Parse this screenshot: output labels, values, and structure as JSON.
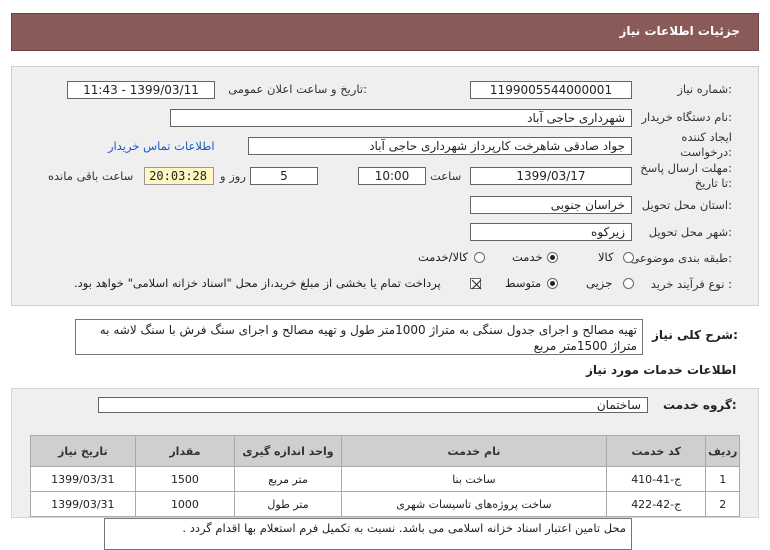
{
  "header": {
    "title": "جزئیات اطلاعات نیاز"
  },
  "form": {
    "need_number_label": "شماره نیاز:",
    "need_number": "1199005544000001",
    "announce_label": "تاریخ و ساعت اعلان عمومی:",
    "announce_value": "1399/03/11 - 11:43",
    "buyer_org_label": "نام دستگاه خریدار:",
    "buyer_org": "شهرداری حاجی آباد",
    "creator_label_1": "ایجاد کننده",
    "creator_label_2": "درخواست:",
    "creator": "جواد صادقی شاهرخت کارپرداز شهرداری حاجی آباد",
    "contact_link": "اطلاعات تماس خریدار",
    "deadline_label_1": "مهلت ارسال پاسخ:",
    "deadline_label_2": "تا تاریخ:",
    "deadline_date": "1399/03/17",
    "time_label": "ساعت",
    "deadline_time": "10:00",
    "days_value": "5",
    "days_label": "روز و",
    "remaining_time": "20:03:28",
    "remaining_label": "ساعت باقی مانده",
    "province_label": "استان محل تحویل:",
    "province": "خراسان جنوبی",
    "city_label": "شهر محل تحویل:",
    "city": "زیرکوه",
    "category_label": "طبقه بندی موضوعی:",
    "category_options": [
      "کالا",
      "خدمت",
      "کالا/خدمت"
    ],
    "category_selected": "خدمت",
    "process_label": "نوع فرآیند خرید :",
    "process_options": [
      "جزیی",
      "متوسط"
    ],
    "process_selected": "متوسط",
    "payment_note": "پرداخت تمام یا بخشی از مبلغ خرید،از محل \"اسناد خزانه اسلامی\" خواهد بود.",
    "payment_checked": true
  },
  "description": {
    "label": "شرح کلی نیاز:",
    "text": "تهیه مصالح و اجرای جدول سنگی به متراژ 1000متر طول و تهیه مصالح و اجرای سنگ فرش با سنگ لاشه به متراژ 1500متر مربع"
  },
  "services": {
    "title": "اطلاعات خدمات مورد نیاز",
    "group_label": "گروه خدمت:",
    "group_value": "ساختمان",
    "columns": [
      "ردیف",
      "کد خدمت",
      "نام خدمت",
      "واحد اندازه گیری",
      "مقدار",
      "تاریخ نیاز"
    ],
    "rows": [
      [
        "1",
        "ج-41-410",
        "ساخت بنا",
        "متر مربع",
        "1500",
        "1399/03/31"
      ],
      [
        "2",
        "ج-42-422",
        "ساخت پروژه‌های تاسیسات شهری",
        "متر طول",
        "1000",
        "1399/03/31"
      ]
    ],
    "note": "محل تامین اعتبار اسناد خزانه اسلامی می باشد. نسبت به تکمیل فرم استعلام بها اقدام گردد ."
  }
}
